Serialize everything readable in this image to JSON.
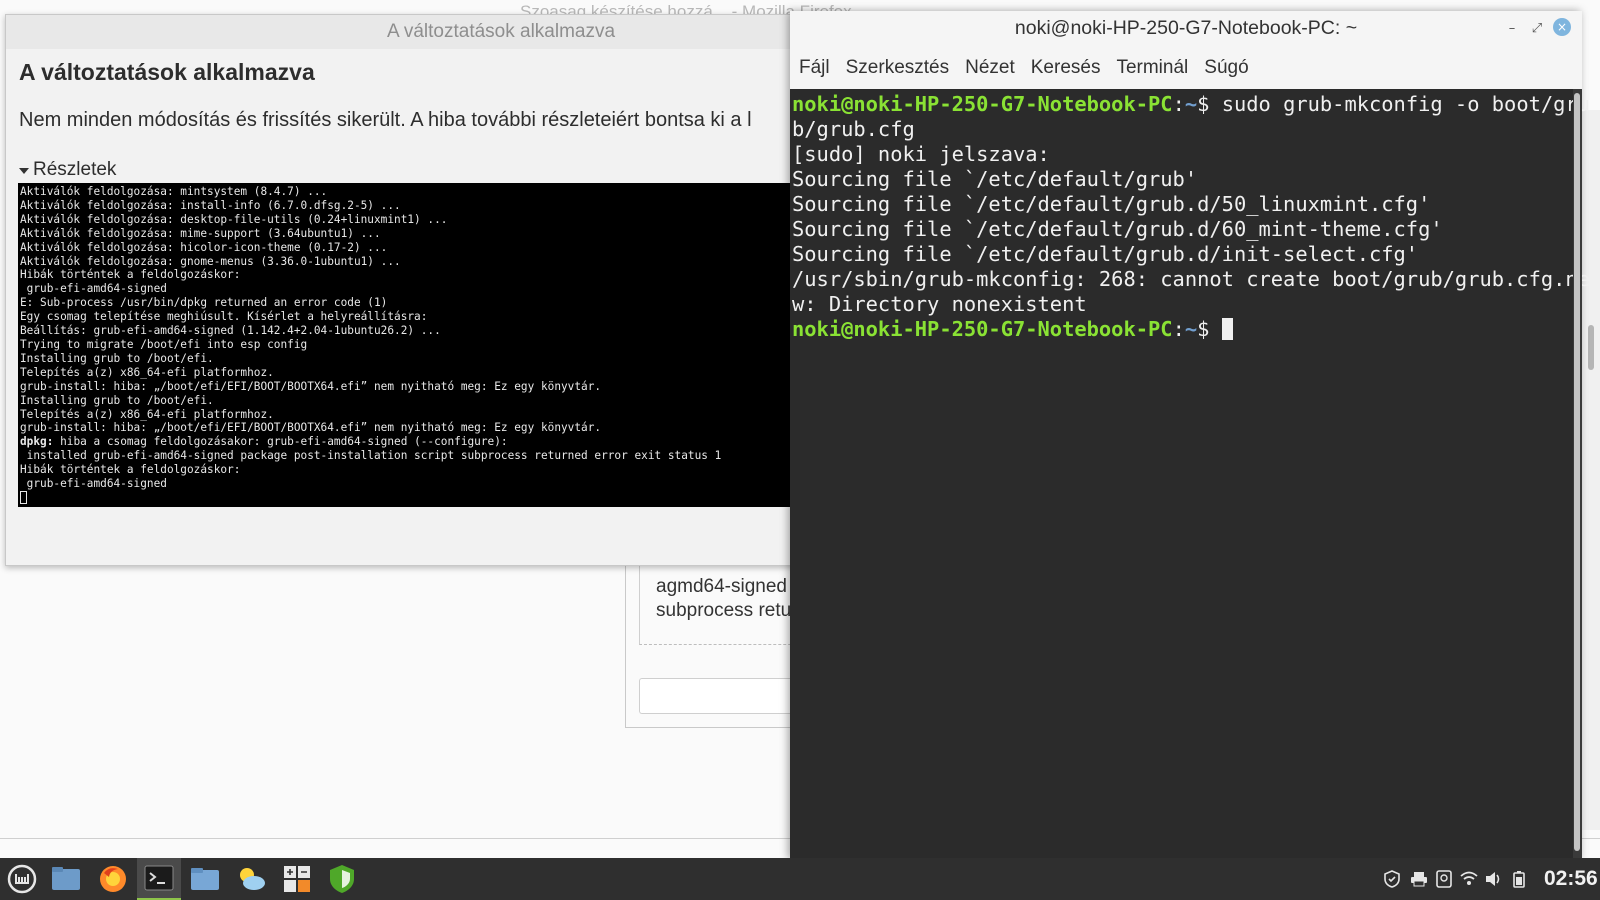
{
  "firefox": {
    "title": "Szoasag készítése hozzá... - Mozilla Firefox"
  },
  "background_dialog": {
    "text_lines": "agmd64-signed p\nsubprocess retu"
  },
  "apply_dialog": {
    "title": "A változtatások alkalmazva",
    "heading": "A változtatások alkalmazva",
    "message": "Nem minden módosítás és frissítés sikerült. A hiba további részleteiért bontsa ki a l",
    "details_label": "Részletek",
    "log_lines": [
      "Aktiválók feldolgozása: mintsystem (8.4.7) ...",
      "Aktiválók feldolgozása: install-info (6.7.0.dfsg.2-5) ...",
      "Aktiválók feldolgozása: desktop-file-utils (0.24+linuxmint1) ...",
      "Aktiválók feldolgozása: mime-support (3.64ubuntu1) ...",
      "Aktiválók feldolgozása: hicolor-icon-theme (0.17-2) ...",
      "Aktiválók feldolgozása: gnome-menus (3.36.0-1ubuntu1) ...",
      "Hibák történtek a feldolgozáskor:",
      " grub-efi-amd64-signed",
      "E: Sub-process /usr/bin/dpkg returned an error code (1)",
      "Egy csomag telepítése meghiúsult. Kísérlet a helyreállításra:",
      "Beállítás: grub-efi-amd64-signed (1.142.4+2.04-1ubuntu26.2) ...",
      "Trying to migrate /boot/efi into esp config",
      "Installing grub to /boot/efi.",
      "Telepítés a(z) x86_64-efi platformhoz.",
      "grub-install: hiba: „/boot/efi/EFI/BOOT/BOOTX64.efi” nem nyitható meg: Ez egy könyvtár.",
      "Installing grub to /boot/efi.",
      "Telepítés a(z) x86_64-efi platformhoz.",
      "grub-install: hiba: „/boot/efi/EFI/BOOT/BOOTX64.efi” nem nyitható meg: Ez egy könyvtár.",
      "hiba a csomag feldolgozásakor: grub-efi-amd64-signed (--configure):",
      " installed grub-efi-amd64-signed package post-installation script subprocess returned error exit status 1",
      "Hibák történtek a feldolgozáskor:",
      " grub-efi-amd64-signed"
    ],
    "dpkg_prefix": "dpkg:"
  },
  "terminal": {
    "title": "noki@noki-HP-250-G7-Notebook-PC: ~",
    "menu": [
      "Fájl",
      "Szerkesztés",
      "Nézet",
      "Keresés",
      "Terminál",
      "Súgó"
    ],
    "prompt_user": "noki@noki-HP-250-G7-Notebook-PC",
    "prompt_path": "~",
    "prompt_sep": ":",
    "prompt_dollar": "$ ",
    "command_part1": "sudo grub-mkconfig -o boot/gru",
    "command_part2": "b/grub.cfg",
    "output_lines": [
      "[sudo] noki jelszava:",
      "Sourcing file `/etc/default/grub'",
      "Sourcing file `/etc/default/grub.d/50_linuxmint.cfg'",
      "Sourcing file `/etc/default/grub.d/60_mint-theme.cfg'",
      "Sourcing file `/etc/default/grub.d/init-select.cfg'",
      "/usr/sbin/grub-mkconfig: 268: cannot create boot/grub/grub.cfg.ne",
      "w: Directory nonexistent"
    ],
    "close_glyph": "×",
    "minimize_glyph": "–",
    "maximize_glyph": "⤢"
  },
  "taskbar": {
    "clock": "02:56",
    "items": [
      "menu-icon",
      "files-icon",
      "firefox-icon",
      "terminal-icon",
      "folder-icon",
      "weather-icon",
      "calculator-icon",
      "update-manager-icon"
    ]
  },
  "colors": {
    "prompt_user": "#8ae234",
    "prompt_path": "#729fcf",
    "terminal_bg": "#2b2b2b",
    "taskbar_bg": "#2f2f2f"
  }
}
